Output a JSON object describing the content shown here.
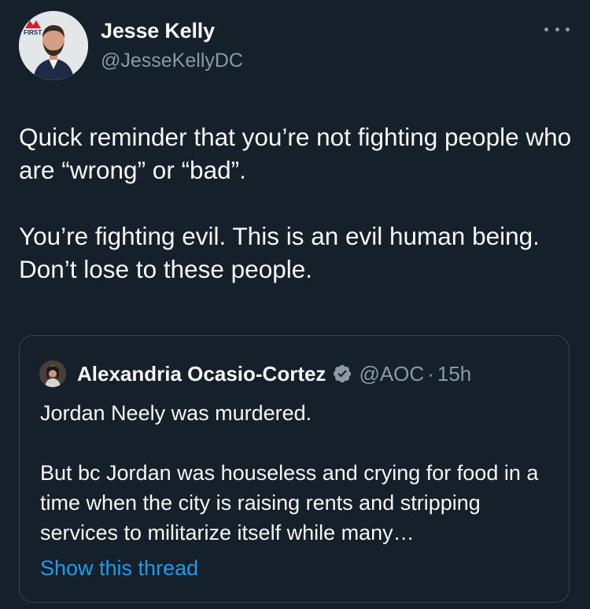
{
  "tweet": {
    "author_name": "Jesse Kelly",
    "author_handle": "@JesseKellyDC",
    "paragraphs": [
      "Quick reminder that you’re not fighting people who are “wrong” or “bad”.",
      "You’re fighting evil. This is an evil human being. Don’t lose to these people."
    ],
    "avatar_logo_text": "FIRST"
  },
  "quoted": {
    "author_name": "Alexandria Ocasio-Cortez",
    "author_handle": "@AOC",
    "separator": "·",
    "time": "15h",
    "paragraphs": [
      "Jordan Neely was murdered.",
      "But bc Jordan was houseless and crying for food in a time when the city is raising rents and stripping services to militarize itself while many…"
    ],
    "show_thread_label": "Show this thread"
  },
  "colors": {
    "background": "#15202b",
    "text": "#f7f9f9",
    "secondary_text": "#8b98a5",
    "link": "#1d9bf0",
    "border": "#38444d",
    "verified_badge": "#8b98a5"
  },
  "icons": {
    "more": "more-horizontal-icon",
    "verified": "verified-badge-icon"
  }
}
